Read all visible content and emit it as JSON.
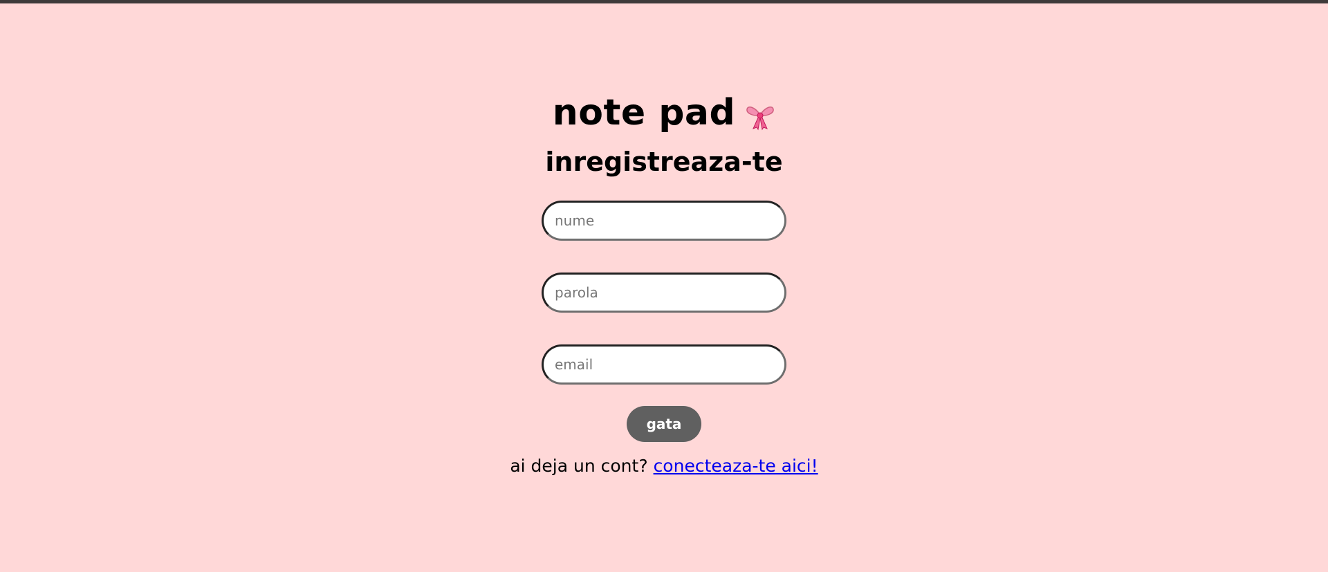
{
  "app": {
    "title": "note pad",
    "icon": "bow-icon"
  },
  "form": {
    "heading": "inregistreaza-te",
    "fields": [
      {
        "name": "nume",
        "placeholder": "nume",
        "value": ""
      },
      {
        "name": "parola",
        "placeholder": "parola",
        "value": ""
      },
      {
        "name": "email",
        "placeholder": "email",
        "value": ""
      }
    ],
    "submit_label": "gata"
  },
  "footer": {
    "prompt": "ai deja un cont?",
    "link_label": "conecteaza-te aici!"
  },
  "colors": {
    "background": "#ffd8d8",
    "top_bar": "#3e3a3a",
    "button": "#606060",
    "link": "#0000ee",
    "bow": "#f48fb1"
  }
}
